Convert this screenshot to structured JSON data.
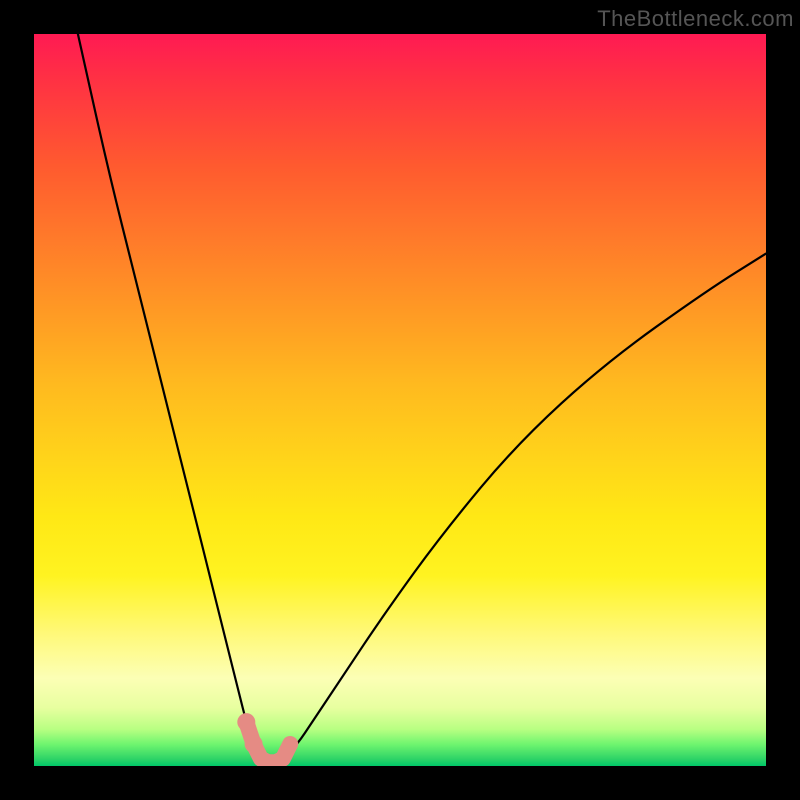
{
  "watermark": "TheBottleneck.com",
  "chart_data": {
    "type": "line",
    "title": "",
    "xlabel": "",
    "ylabel": "",
    "xlim": [
      0,
      100
    ],
    "ylim": [
      0,
      100
    ],
    "series": [
      {
        "name": "bottleneck-curve",
        "x": [
          6,
          10,
          14,
          18,
          22,
          24,
          26,
          28,
          29,
          30,
          31,
          32,
          33,
          34,
          36,
          38,
          42,
          48,
          56,
          66,
          78,
          92,
          100
        ],
        "y": [
          100,
          82,
          66,
          50,
          34,
          26,
          18,
          10,
          6,
          3,
          1,
          0.5,
          0.5,
          1,
          3,
          6,
          12,
          21,
          32,
          44,
          55,
          65,
          70
        ]
      }
    ],
    "highlight": {
      "name": "optimal-band-marker",
      "x": [
        29,
        30,
        31,
        32,
        33,
        34,
        35
      ],
      "y": [
        6,
        3,
        1,
        0.5,
        0.5,
        1,
        3
      ]
    },
    "background": "vertical-heatmap-gradient-red-yellow-green"
  }
}
